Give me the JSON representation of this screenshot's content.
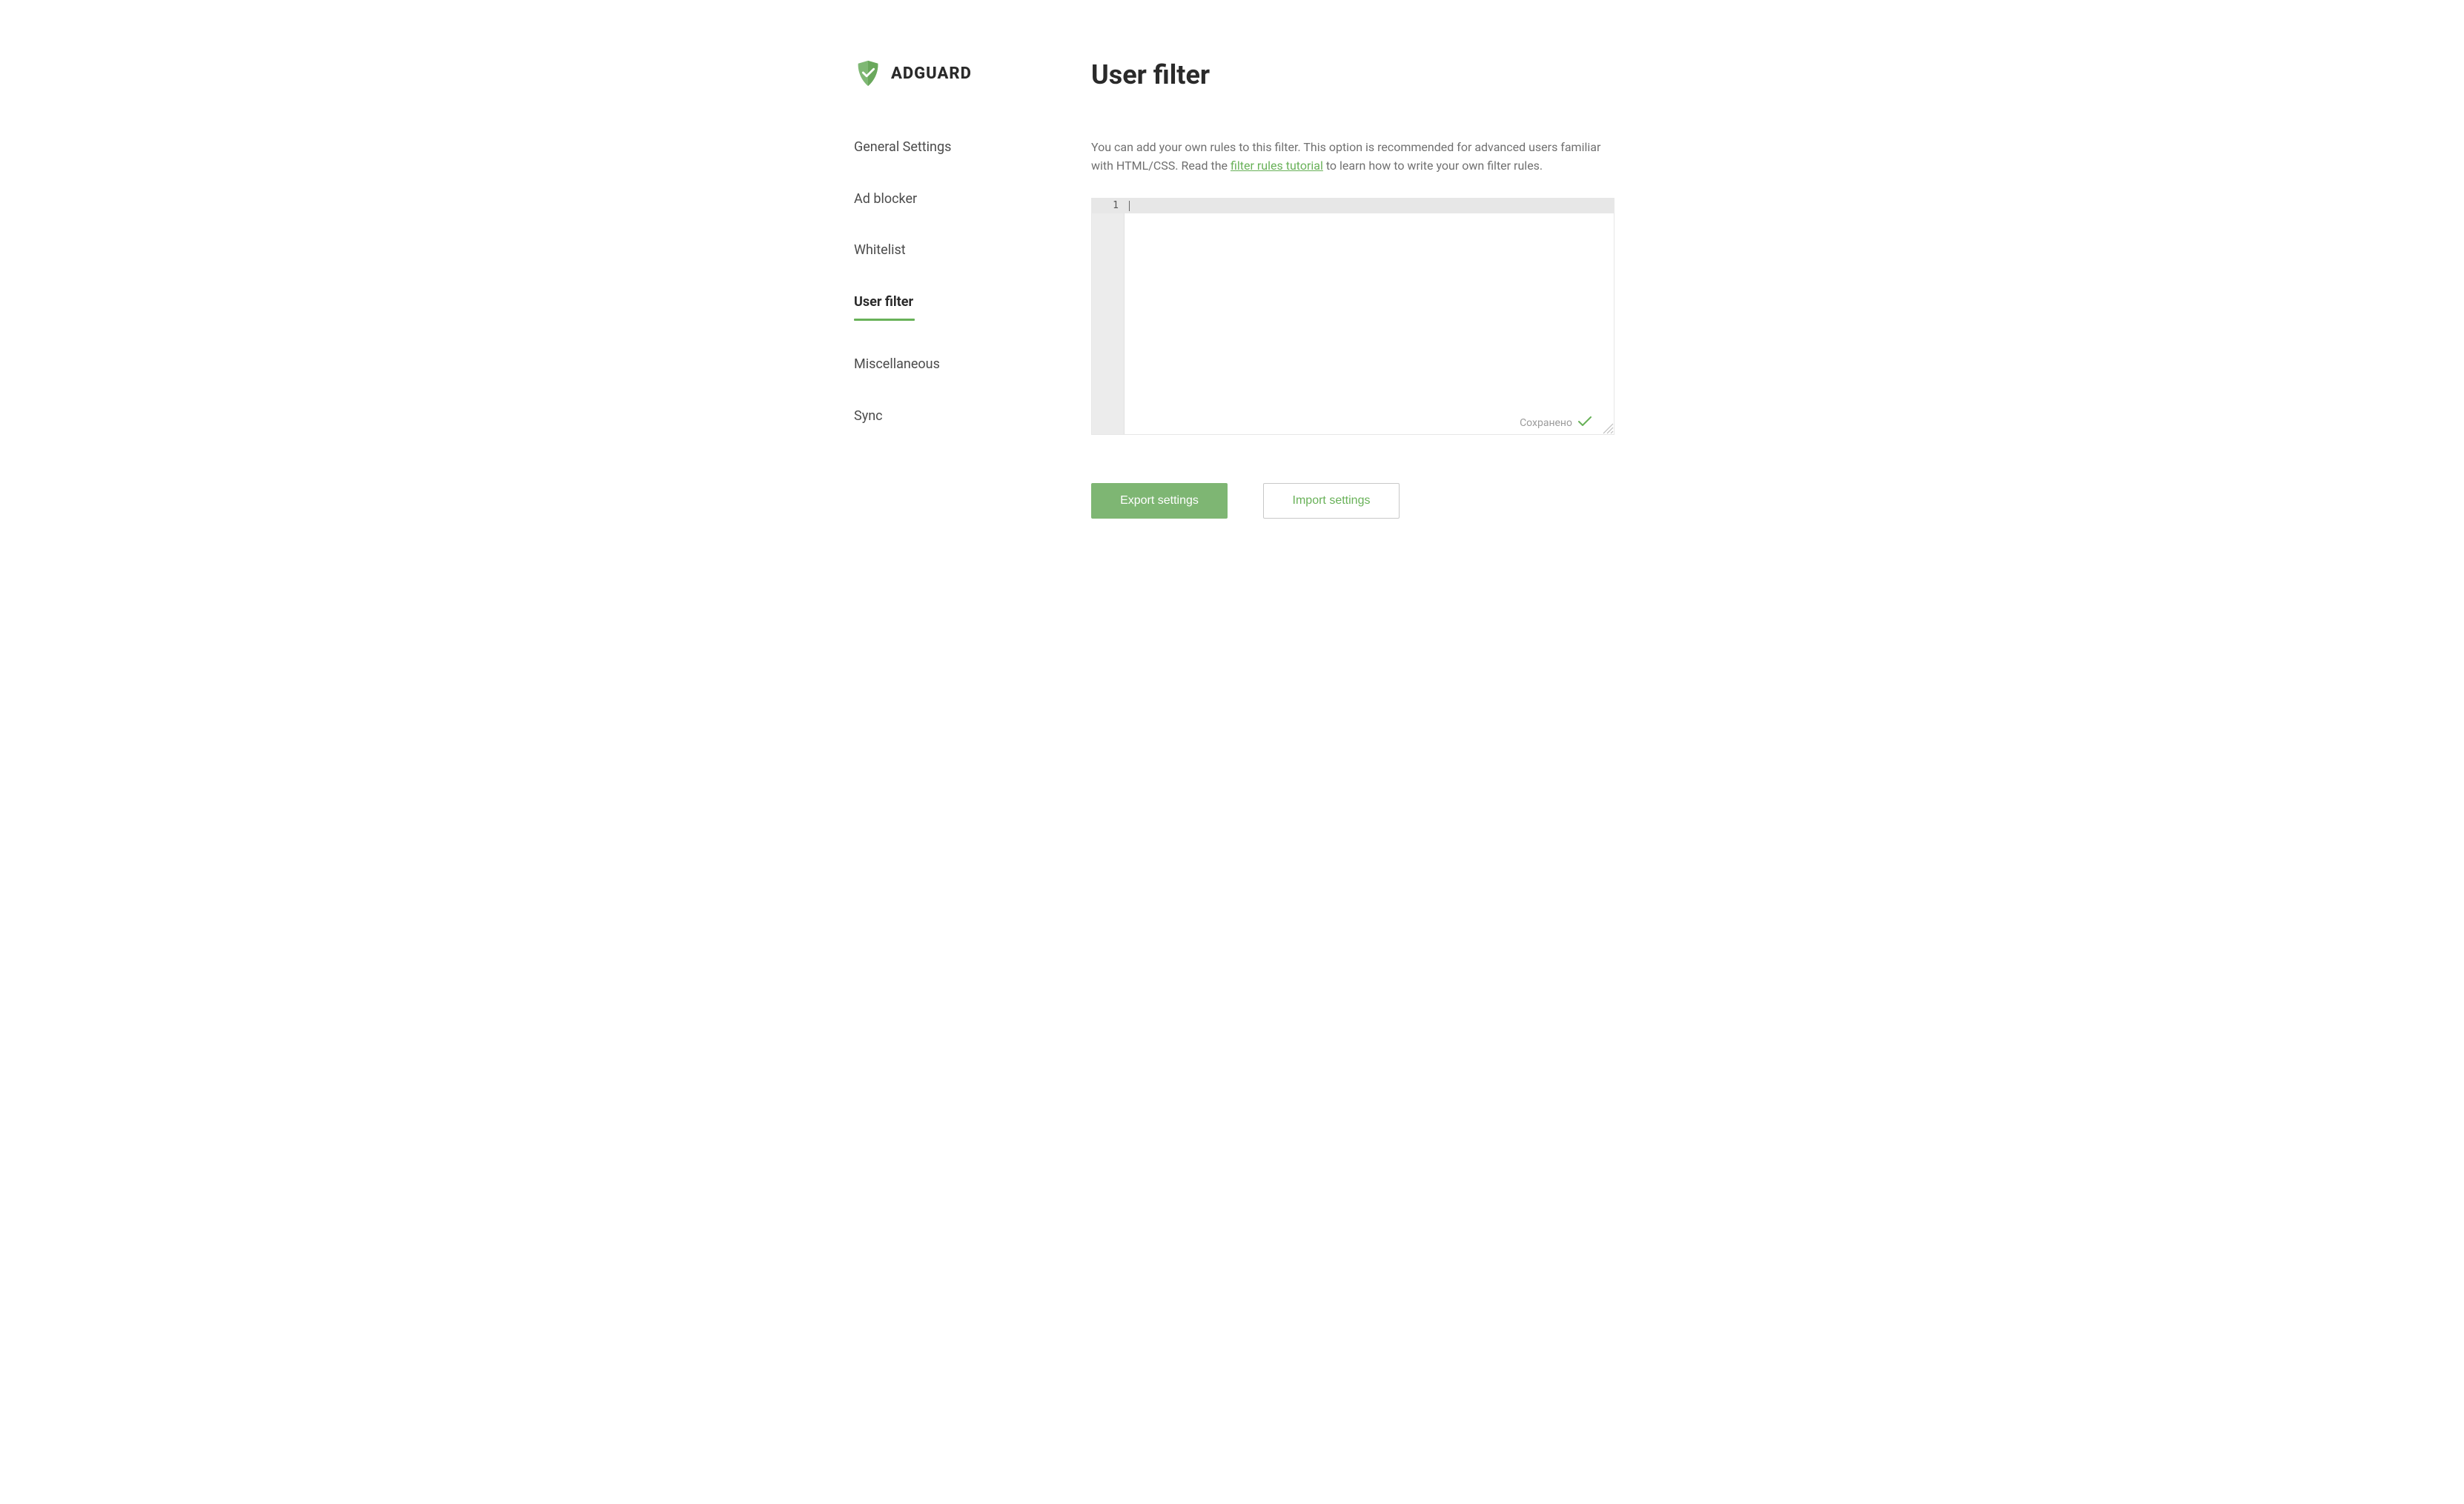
{
  "brand": {
    "name": "ADGUARD",
    "accentColor": "#68b158"
  },
  "sidebar": {
    "items": [
      {
        "id": "general",
        "label": "General Settings",
        "active": false
      },
      {
        "id": "adblocker",
        "label": "Ad blocker",
        "active": false
      },
      {
        "id": "whitelist",
        "label": "Whitelist",
        "active": false
      },
      {
        "id": "userfilter",
        "label": "User filter",
        "active": true
      },
      {
        "id": "miscellaneous",
        "label": "Miscellaneous",
        "active": false
      },
      {
        "id": "sync",
        "label": "Sync",
        "active": false
      }
    ]
  },
  "page": {
    "title": "User filter",
    "description_pre": "You can add your own rules to this filter. This option is recommended for advanced users familiar with HTML/CSS. Read the ",
    "description_link": "filter rules tutorial",
    "description_post": " to learn how to write your own filter rules."
  },
  "editor": {
    "firstLineNumber": "1",
    "content": "",
    "savedLabel": "Сохранено"
  },
  "buttons": {
    "export": "Export settings",
    "import": "Import settings"
  }
}
